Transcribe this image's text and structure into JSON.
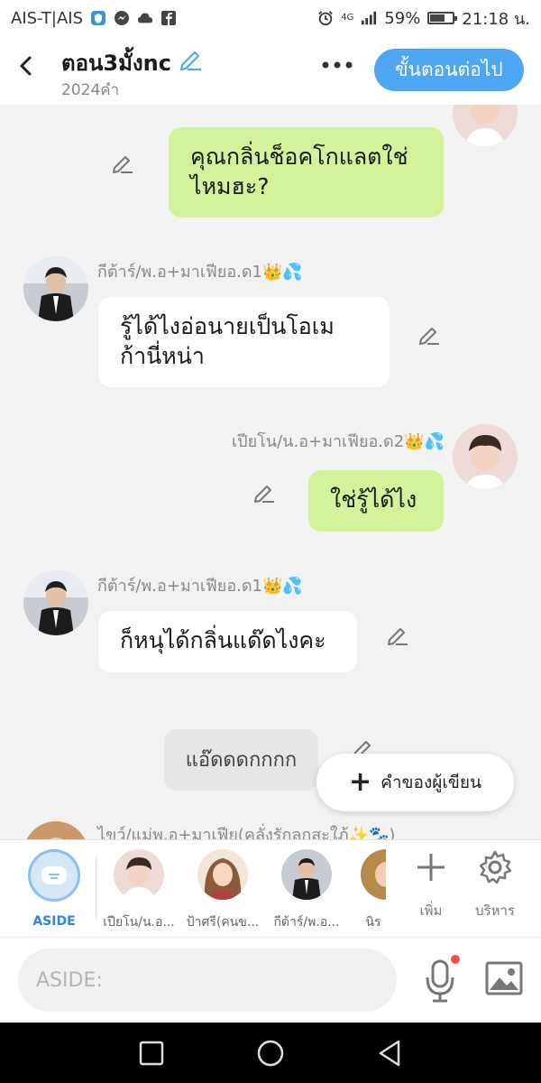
{
  "status_bar": {
    "carrier": "AIS-T|AIS",
    "network": "4G",
    "battery": "59%",
    "battery_level": 0.59,
    "time": "21:18 น."
  },
  "header": {
    "title": "ตอน3มั้งnc",
    "subtitle": "2024คำ",
    "next_label": "ขั้นตอนต่อไป"
  },
  "messages": [
    {
      "side": "right",
      "color": "green",
      "text": "คุณกลิ่นช็อคโกแลตใช่ไหมฮะ?"
    },
    {
      "side": "left",
      "name": "กีต้าร์/พ.อ+มาเฟียอ.ด1",
      "name_emoji": "👑💦",
      "color": "white",
      "text": "รู้ได้ไงอ่อนายเป็นโอเมก้านี่หน่า"
    },
    {
      "side": "right",
      "name": "เปียโน/น.อ+มาเฟียอ.ด2",
      "name_emoji": "👑💦",
      "color": "green",
      "text": "ใช่รู้ได้ไง"
    },
    {
      "side": "left",
      "name": "กีต้าร์/พ.อ+มาเฟียอ.ด1",
      "name_emoji": "👑💦",
      "color": "white",
      "text": "ก็หนุได้กลิ่นแด๊ดไงคะ"
    },
    {
      "side": "center",
      "color": "gray",
      "text": "แอ๊ดดดกกกก"
    },
    {
      "side": "left",
      "name": "ไขว์/แม่พ.อ+มาเฟีย(คลั่งรักลูกสะใภ้",
      "name_emoji": "✨🐾)",
      "color": "white",
      "text": ""
    }
  ],
  "fab": {
    "label": "คำของผู้เขียน"
  },
  "characters": [
    {
      "label": "ASIDE",
      "kind": "aside"
    },
    {
      "label": "เปียโน/น.อ...",
      "kind": "photo",
      "tone": "#e9d6d3"
    },
    {
      "label": "ป้าศรี(คนข...",
      "kind": "drawn",
      "tone": "#8a5a3a"
    },
    {
      "label": "กีต้าร์/พ.อ...",
      "kind": "photo",
      "tone": "#2a2a2a"
    },
    {
      "label": "นิร",
      "kind": "photo",
      "tone": "#b58a4a"
    }
  ],
  "tools": {
    "add_label": "เพิ่ม",
    "manage_label": "บริหาร"
  },
  "input": {
    "placeholder": "ASIDE:"
  }
}
